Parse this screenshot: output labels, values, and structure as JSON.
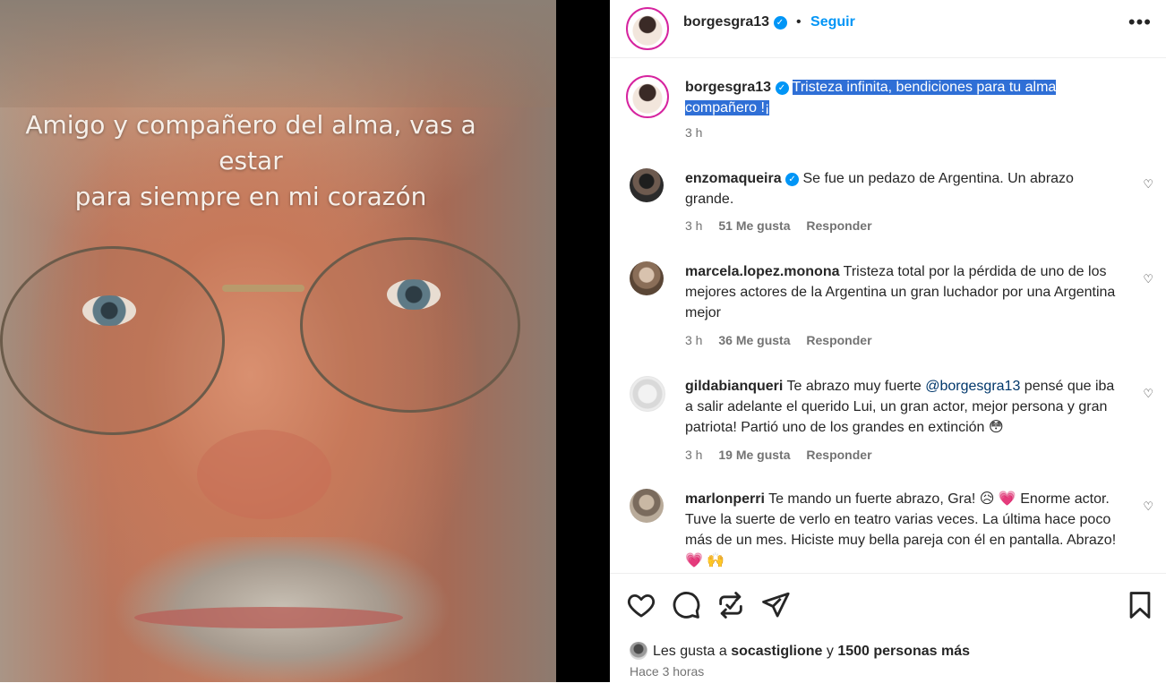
{
  "media": {
    "caption_line1": "Amigo y compañero del alma, vas a estar",
    "caption_line2": "para siempre en mi corazón"
  },
  "header": {
    "username": "borgesgra13",
    "separator": "•",
    "follow_label": "Seguir",
    "more_icon": "more-horizontal-icon"
  },
  "post": {
    "username": "borgesgra13",
    "caption": "Tristeza infinita, bendiciones para tu alma compañero !¡",
    "time": "3 h"
  },
  "comments": [
    {
      "username": "enzomaqueira",
      "verified": true,
      "text": "Se fue un pedazo de Argentina. Un abrazo grande.",
      "time": "3 h",
      "likes": "51 Me gusta",
      "reply": "Responder"
    },
    {
      "username": "marcela.lopez.monona",
      "verified": false,
      "text": "Tristeza total por la pérdida de uno de los mejores actores de la Argentina un gran luchador por una Argentina mejor",
      "time": "3 h",
      "likes": "36 Me gusta",
      "reply": "Responder"
    },
    {
      "username": "gildabianqueri",
      "verified": false,
      "text_before": "Te abrazo muy fuerte ",
      "mention": "@borgesgra13",
      "text_after": " pensé que iba a salir adelante el querido Lui, un gran actor, mejor persona y gran patriota! Partió uno de los grandes en extinción 😳",
      "time": "3 h",
      "likes": "19 Me gusta",
      "reply": "Responder"
    },
    {
      "username": "marlonperri",
      "verified": false,
      "text": "Te mando un fuerte abrazo, Gra! 😥 💗 Enorme actor. Tuve la suerte de verlo en teatro varias veces. La última hace poco más de un mes. Hiciste muy bella pareja con él en pantalla. Abrazo! 💗 🙌"
    }
  ],
  "actions": {
    "icons": [
      "heart-icon",
      "comment-icon",
      "share-icon",
      "send-icon",
      "bookmark-icon"
    ]
  },
  "likes_summary": {
    "prefix": "Les gusta a",
    "user": "socastiglione",
    "connector": "y",
    "others": "1500 personas más"
  },
  "posted_ago": "Hace 3 horas",
  "colors": {
    "accent": "#0095f6",
    "selection": "#2f6fd6",
    "mention": "#00376b",
    "muted": "#737373"
  }
}
